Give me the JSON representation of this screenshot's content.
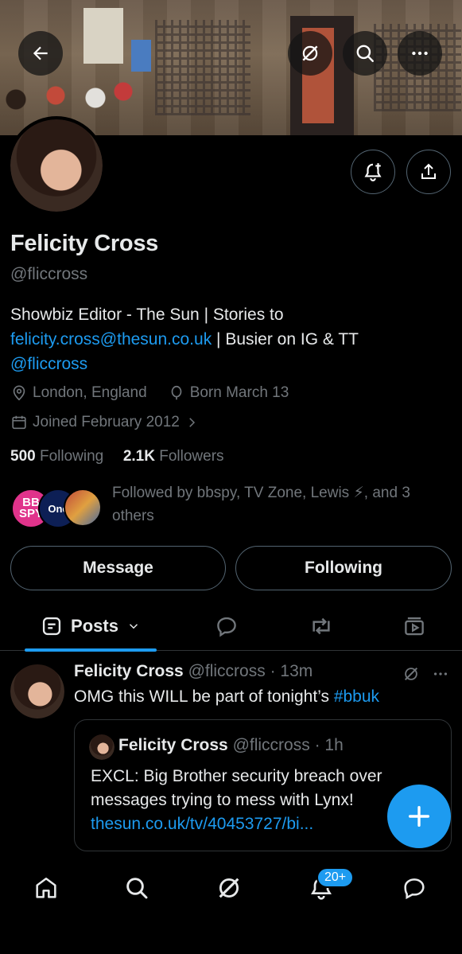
{
  "header": {
    "back_icon": "arrow-left-icon",
    "grok_icon": "grok-icon",
    "search_icon": "search-icon",
    "more_icon": "more-horizontal-icon",
    "notify_icon": "bell-plus-icon",
    "share_icon": "share-icon"
  },
  "profile": {
    "name": "Felicity Cross",
    "handle": "@fliccross",
    "bio_part1": "Showbiz Editor - The Sun | Stories to ",
    "bio_email": "felicity.cross@thesun.co.uk",
    "bio_part2": " | Busier on IG & TT ",
    "bio_mention": "@fliccross",
    "location": "London, England",
    "birthday": "Born March 13",
    "joined": "Joined February 2012",
    "following_count": "500",
    "following_label": "Following",
    "followers_count": "2.1K",
    "followers_label": "Followers",
    "followed_by": "Followed by bbspy, TV Zone, Lewis ⚡, and 3 others",
    "followed_avatar_1": "BB SPY",
    "followed_avatar_2": "One"
  },
  "actions": {
    "message_label": "Message",
    "following_label": "Following"
  },
  "tabs": {
    "posts_label": "Posts",
    "posts_icon": "posts-icon",
    "replies_icon": "reply-icon",
    "reposts_icon": "repost-icon",
    "media_icon": "media-icon"
  },
  "post": {
    "author": "Felicity Cross",
    "handle_time": "@fliccross · 13m",
    "text_plain": "OMG this WILL be part of tonight’s ",
    "text_hashtag": "#bbuk",
    "quote": {
      "author": "Felicity Cross",
      "handle_time": "@fliccross · 1h",
      "line1": "EXCL: Big Brother security breach over",
      "line2": "messages trying to mess with Lynx!",
      "link": "thesun.co.uk/tv/40453727/bi..."
    }
  },
  "fab": {
    "icon": "plus-icon"
  },
  "bottom_nav": {
    "home_icon": "home-icon",
    "search_icon": "search-icon",
    "grok_icon": "grok-icon",
    "notifications_icon": "bell-icon",
    "notifications_badge": "20+",
    "messages_icon": "message-icon"
  },
  "colors": {
    "accent": "#1d9bf0",
    "background": "#000000",
    "text": "#e7e9ea",
    "secondary_text": "#71767b",
    "border": "#2f3336"
  }
}
